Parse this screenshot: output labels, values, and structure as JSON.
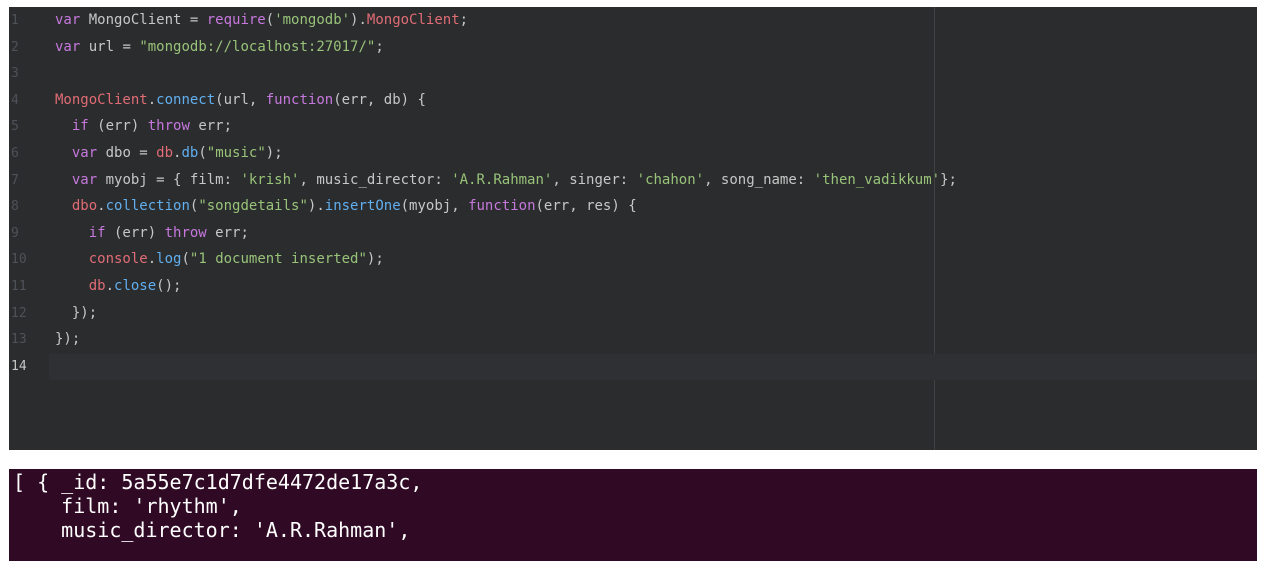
{
  "editor": {
    "lines": [
      {
        "num": "1",
        "tokens": [
          {
            "t": "var",
            "c": "kw"
          },
          {
            "t": " MongoClient = ",
            "c": "pl"
          },
          {
            "t": "require",
            "c": "kw"
          },
          {
            "t": "(",
            "c": "pl"
          },
          {
            "t": "'mongodb'",
            "c": "str"
          },
          {
            "t": ").",
            "c": "pl"
          },
          {
            "t": "MongoClient",
            "c": "cls"
          },
          {
            "t": ";",
            "c": "pl"
          }
        ]
      },
      {
        "num": "2",
        "tokens": [
          {
            "t": "var",
            "c": "kw"
          },
          {
            "t": " url = ",
            "c": "pl"
          },
          {
            "t": "\"mongodb://localhost:27017/\"",
            "c": "str"
          },
          {
            "t": ";",
            "c": "pl"
          }
        ]
      },
      {
        "num": "3",
        "tokens": []
      },
      {
        "num": "4",
        "tokens": [
          {
            "t": "MongoClient",
            "c": "cls"
          },
          {
            "t": ".",
            "c": "pl"
          },
          {
            "t": "connect",
            "c": "fn"
          },
          {
            "t": "(url, ",
            "c": "pl"
          },
          {
            "t": "function",
            "c": "kw"
          },
          {
            "t": "(err, db) {",
            "c": "pl"
          }
        ]
      },
      {
        "num": "5",
        "tokens": [
          {
            "t": "  ",
            "c": "pl"
          },
          {
            "t": "if",
            "c": "kw"
          },
          {
            "t": " (err) ",
            "c": "pl"
          },
          {
            "t": "throw",
            "c": "kw"
          },
          {
            "t": " err;",
            "c": "pl"
          }
        ]
      },
      {
        "num": "6",
        "tokens": [
          {
            "t": "  ",
            "c": "pl"
          },
          {
            "t": "var",
            "c": "kw"
          },
          {
            "t": " dbo = ",
            "c": "pl"
          },
          {
            "t": "db",
            "c": "cls"
          },
          {
            "t": ".",
            "c": "pl"
          },
          {
            "t": "db",
            "c": "fn"
          },
          {
            "t": "(",
            "c": "pl"
          },
          {
            "t": "\"music\"",
            "c": "str"
          },
          {
            "t": ");",
            "c": "pl"
          }
        ]
      },
      {
        "num": "7",
        "tokens": [
          {
            "t": "  ",
            "c": "pl"
          },
          {
            "t": "var",
            "c": "kw"
          },
          {
            "t": " myobj = { film: ",
            "c": "pl"
          },
          {
            "t": "'krish'",
            "c": "str"
          },
          {
            "t": ", music_director: ",
            "c": "pl"
          },
          {
            "t": "'A.R.Rahman'",
            "c": "str"
          },
          {
            "t": ", singer: ",
            "c": "pl"
          },
          {
            "t": "'chahon'",
            "c": "str"
          },
          {
            "t": ", song_name: ",
            "c": "pl"
          },
          {
            "t": "'then_vadikkum'",
            "c": "str"
          },
          {
            "t": "};",
            "c": "pl"
          }
        ]
      },
      {
        "num": "8",
        "tokens": [
          {
            "t": "  ",
            "c": "pl"
          },
          {
            "t": "dbo",
            "c": "cls"
          },
          {
            "t": ".",
            "c": "pl"
          },
          {
            "t": "collection",
            "c": "fn"
          },
          {
            "t": "(",
            "c": "pl"
          },
          {
            "t": "\"songdetails\"",
            "c": "str"
          },
          {
            "t": ").",
            "c": "pl"
          },
          {
            "t": "insertOne",
            "c": "fn"
          },
          {
            "t": "(myobj, ",
            "c": "pl"
          },
          {
            "t": "function",
            "c": "kw"
          },
          {
            "t": "(err, res) {",
            "c": "pl"
          }
        ]
      },
      {
        "num": "9",
        "tokens": [
          {
            "t": "    ",
            "c": "pl"
          },
          {
            "t": "if",
            "c": "kw"
          },
          {
            "t": " (err) ",
            "c": "pl"
          },
          {
            "t": "throw",
            "c": "kw"
          },
          {
            "t": " err;",
            "c": "pl"
          }
        ]
      },
      {
        "num": "10",
        "tokens": [
          {
            "t": "    ",
            "c": "pl"
          },
          {
            "t": "console",
            "c": "cls"
          },
          {
            "t": ".",
            "c": "pl"
          },
          {
            "t": "log",
            "c": "fn"
          },
          {
            "t": "(",
            "c": "pl"
          },
          {
            "t": "\"1 document inserted\"",
            "c": "str"
          },
          {
            "t": ");",
            "c": "pl"
          }
        ]
      },
      {
        "num": "11",
        "tokens": [
          {
            "t": "    ",
            "c": "pl"
          },
          {
            "t": "db",
            "c": "cls"
          },
          {
            "t": ".",
            "c": "pl"
          },
          {
            "t": "close",
            "c": "fn"
          },
          {
            "t": "();",
            "c": "pl"
          }
        ]
      },
      {
        "num": "12",
        "tokens": [
          {
            "t": "  });",
            "c": "pl"
          }
        ]
      },
      {
        "num": "13",
        "tokens": [
          {
            "t": "});",
            "c": "pl"
          }
        ]
      },
      {
        "num": "14",
        "tokens": [],
        "current": true
      }
    ]
  },
  "terminal": {
    "lines": [
      "[ { _id: 5a55e7c1d7dfe4472de17a3c,",
      "    film: 'rhythm',",
      "    music_director: 'A.R.Rahman',"
    ]
  },
  "colors": {
    "editor_bg": "#2b2c2e",
    "terminal_bg": "#300a24",
    "keyword": "#c678dd",
    "string": "#98c379",
    "class": "#e06c75",
    "function": "#61afef"
  }
}
